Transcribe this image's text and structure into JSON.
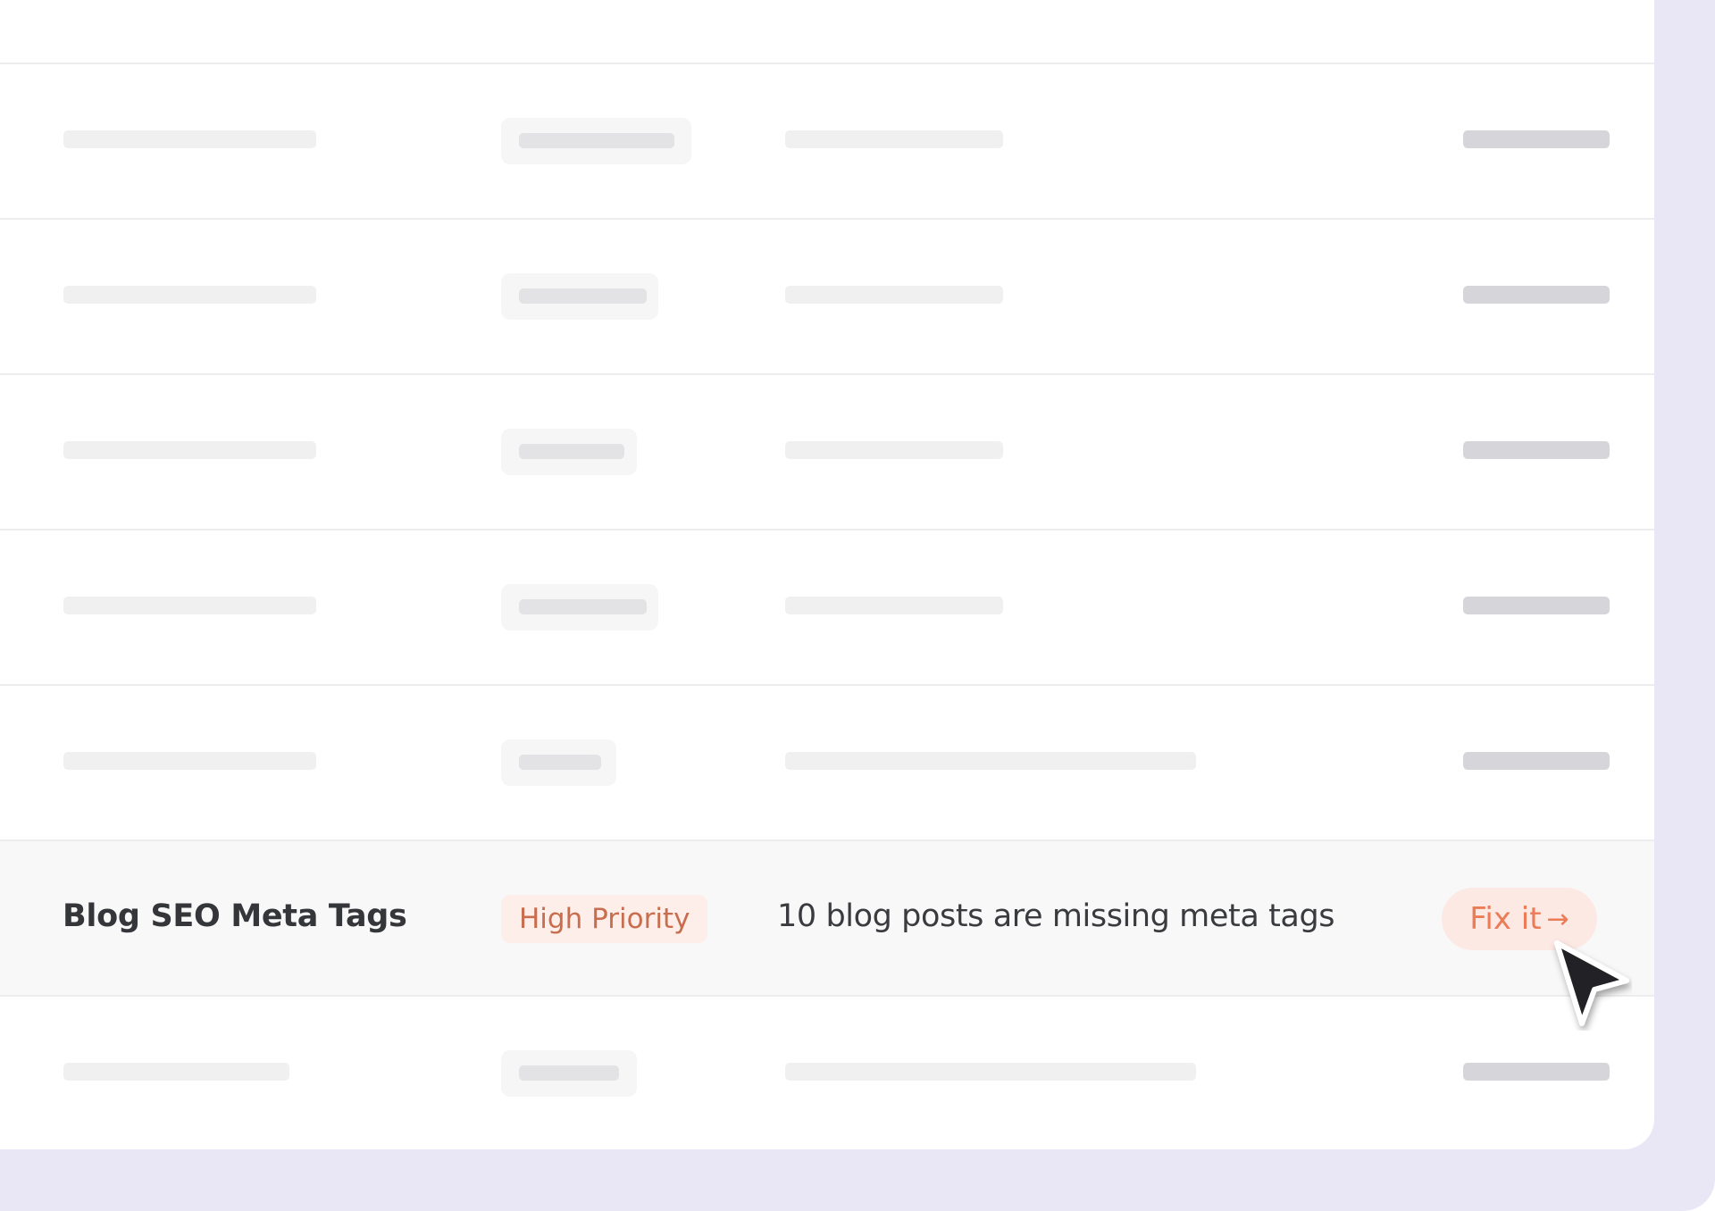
{
  "highlighted_row": {
    "task_name": "Blog SEO Meta Tags",
    "priority": "High Priority",
    "description": "10 blog posts are missing meta tags",
    "action_label": "Fix it",
    "action_arrow": "→"
  },
  "colors": {
    "backdrop": "#e9e7f5",
    "priority_bg": "#fdeee9",
    "priority_text": "#c86d4e",
    "action_bg": "#fce9e3",
    "action_text": "#ec7b57"
  },
  "icons": [
    "arrow-right-icon",
    "mouse-pointer-icon"
  ]
}
